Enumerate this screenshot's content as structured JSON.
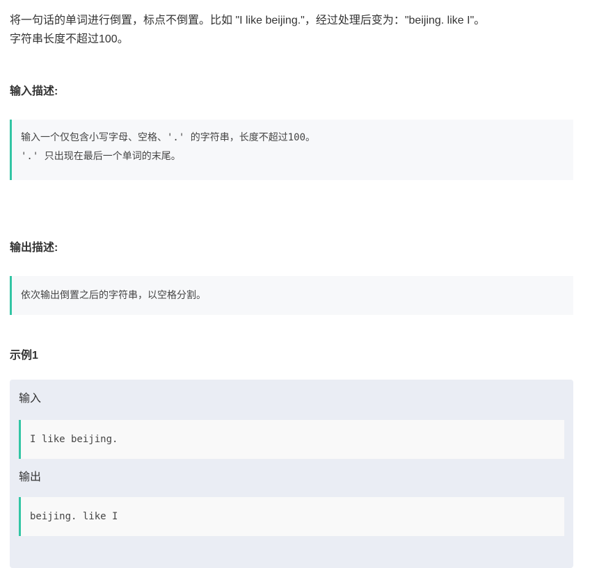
{
  "description": {
    "line1": "将一句话的单词进行倒置，标点不倒置。比如 \"I like beijing.\"，经过处理后变为：\"beijing. like I\"。",
    "line2": "字符串长度不超过100。"
  },
  "input_section": {
    "title": "输入描述:",
    "lines": [
      "输入一个仅包含小写字母、空格、'.' 的字符串，长度不超过100。",
      "'.' 只出现在最后一个单词的末尾。"
    ]
  },
  "output_section": {
    "title": "输出描述:",
    "text": "依次输出倒置之后的字符串，以空格分割。"
  },
  "example": {
    "title": "示例1",
    "input_label": "输入",
    "input_value": "I like beijing.",
    "output_label": "输出",
    "output_value": "beijing. like I"
  },
  "colors": {
    "accent_border": "#32c5a4",
    "example_background": "#eaedf4",
    "quote_background": "#f7f8fa",
    "text": "#333333"
  }
}
